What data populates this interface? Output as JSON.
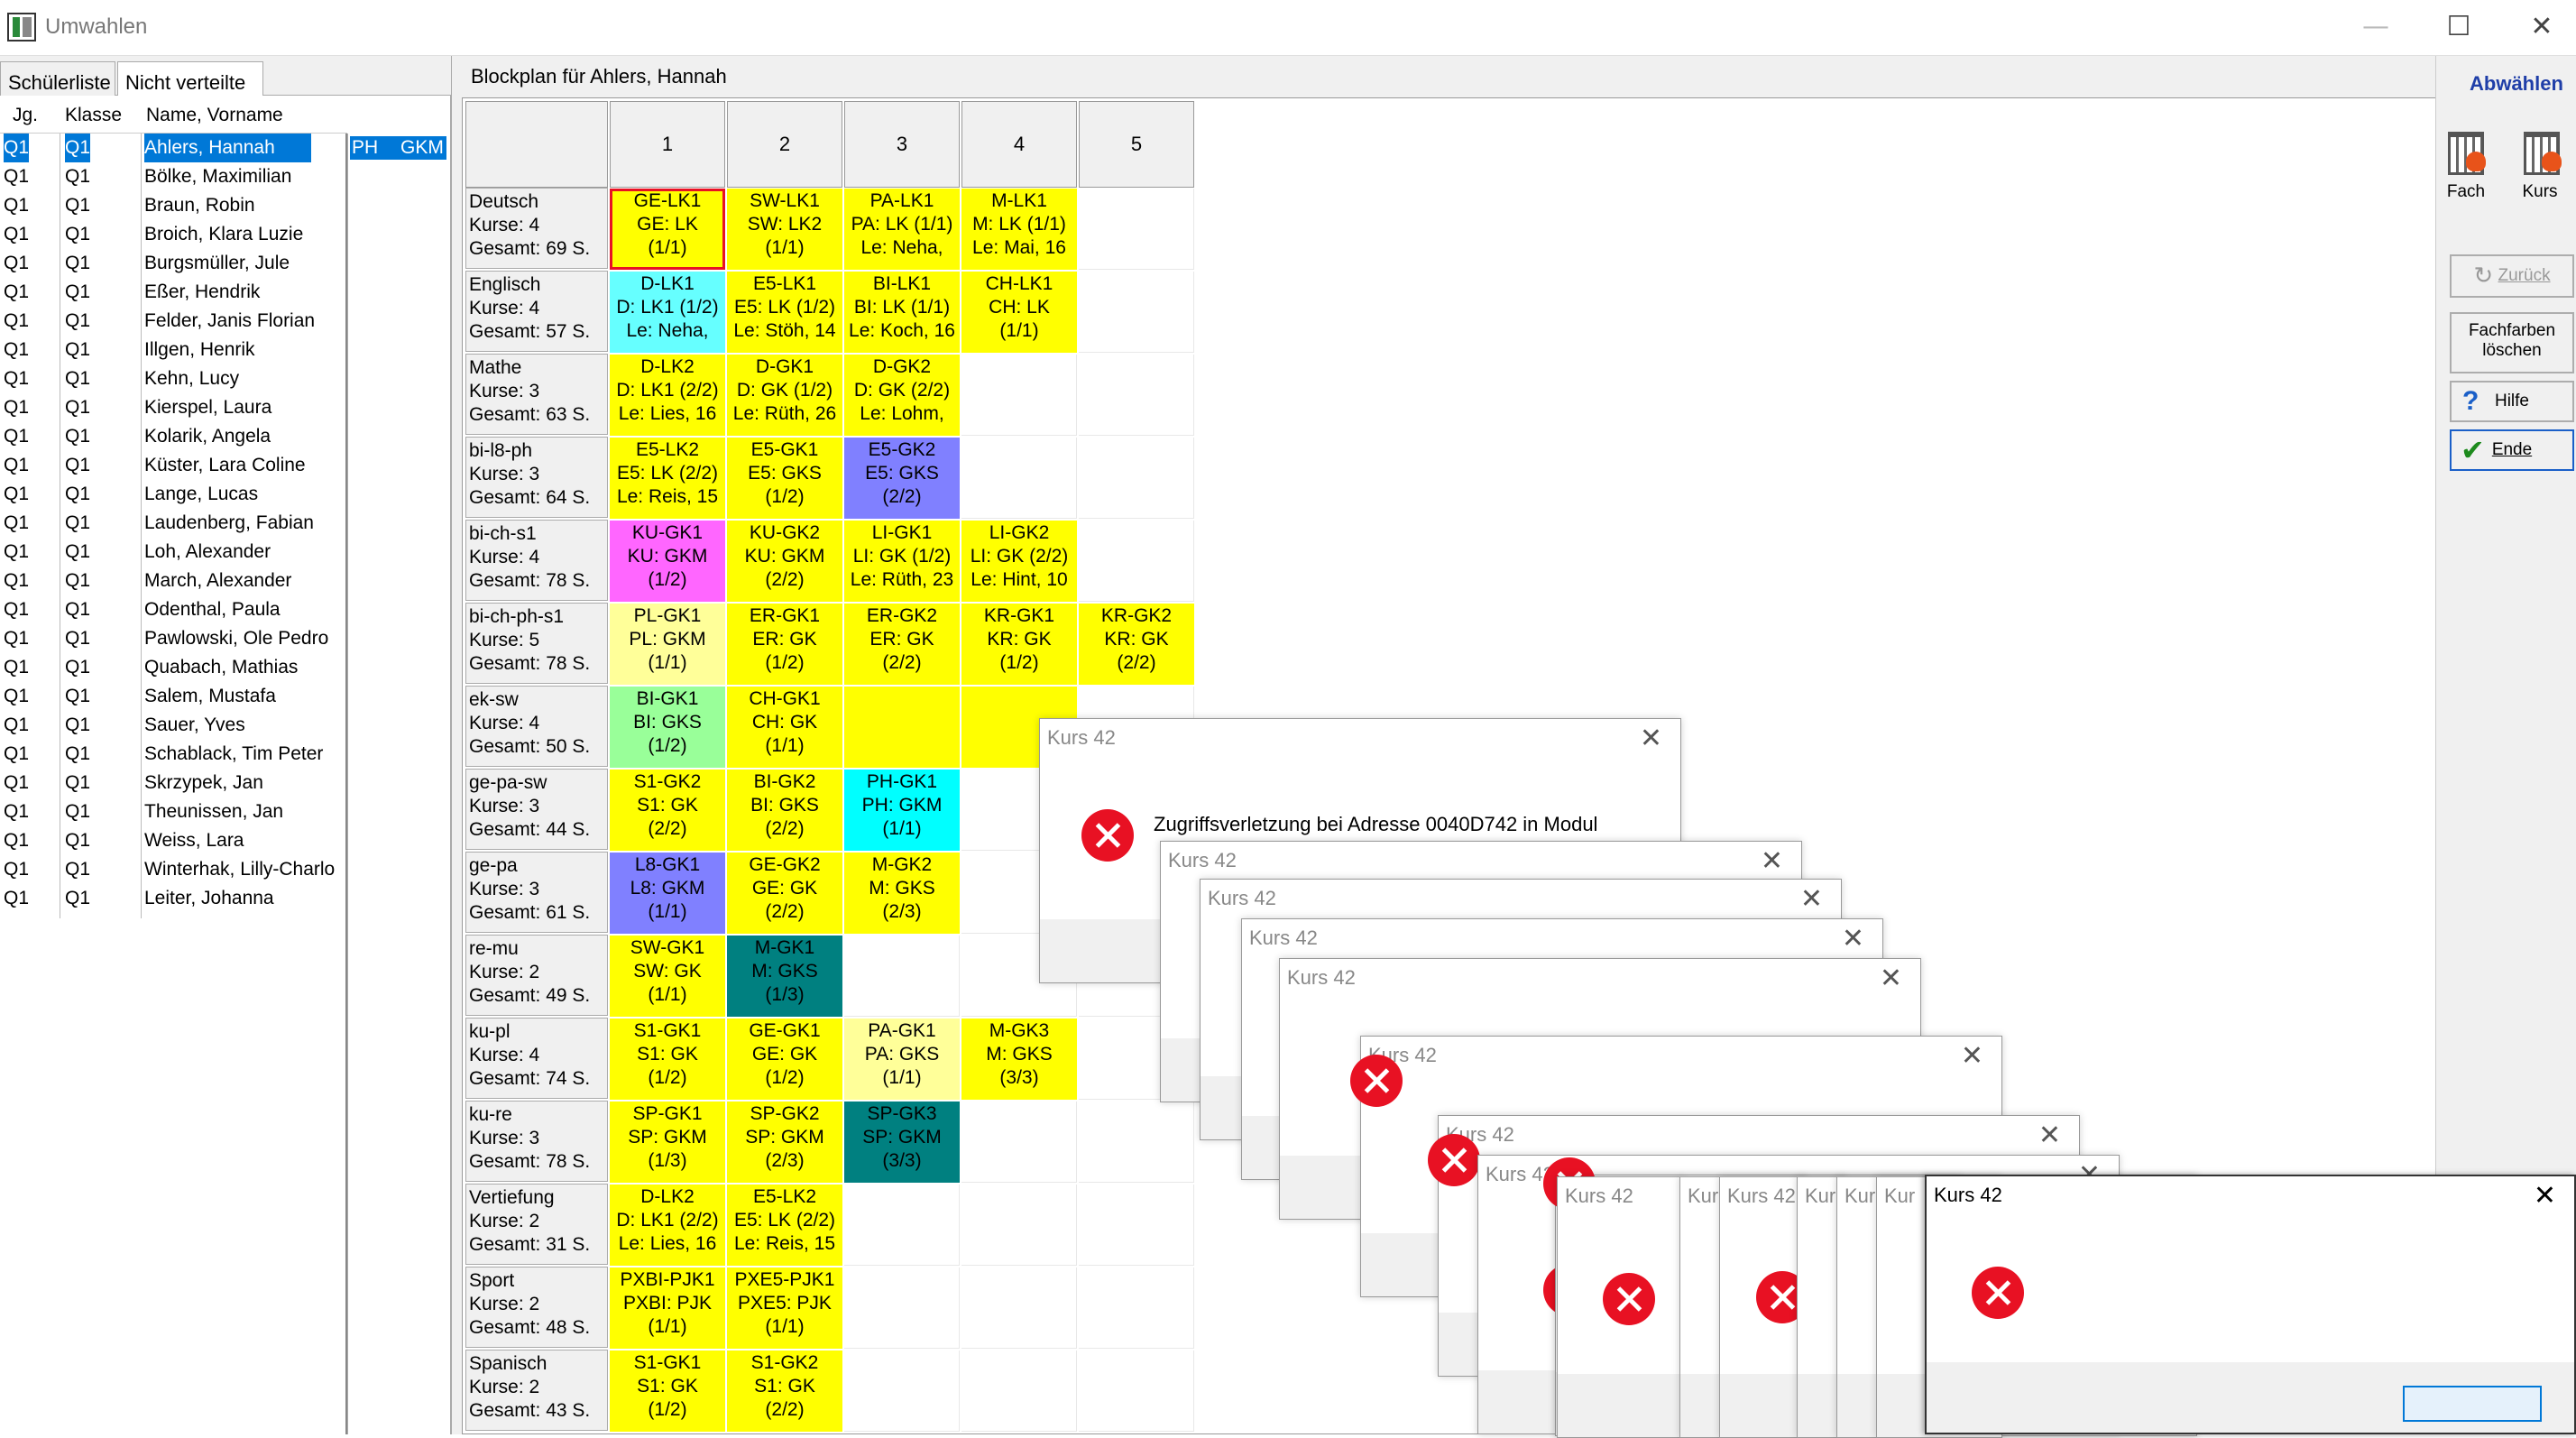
{
  "window": {
    "title": "Umwahlen",
    "minimize": "—",
    "maximize": "☐",
    "close": "✕"
  },
  "tabs": [
    "Schülerliste",
    "Nicht verteilte"
  ],
  "student_list": {
    "headers": [
      "Jg.",
      "Klasse",
      "Name, Vorname"
    ],
    "rows": [
      {
        "jg": "Q1",
        "klasse": "Q1",
        "name": "Ahlers, Hannah"
      },
      {
        "jg": "Q1",
        "klasse": "Q1",
        "name": "Bölke, Maximilian"
      },
      {
        "jg": "Q1",
        "klasse": "Q1",
        "name": "Braun, Robin"
      },
      {
        "jg": "Q1",
        "klasse": "Q1",
        "name": "Broich, Klara Luzie"
      },
      {
        "jg": "Q1",
        "klasse": "Q1",
        "name": "Burgsmüller, Jule"
      },
      {
        "jg": "Q1",
        "klasse": "Q1",
        "name": "Eßer, Hendrik"
      },
      {
        "jg": "Q1",
        "klasse": "Q1",
        "name": "Felder, Janis Florian"
      },
      {
        "jg": "Q1",
        "klasse": "Q1",
        "name": "Illgen, Henrik"
      },
      {
        "jg": "Q1",
        "klasse": "Q1",
        "name": "Kehn, Lucy"
      },
      {
        "jg": "Q1",
        "klasse": "Q1",
        "name": "Kierspel, Laura"
      },
      {
        "jg": "Q1",
        "klasse": "Q1",
        "name": "Kolarik, Angela"
      },
      {
        "jg": "Q1",
        "klasse": "Q1",
        "name": "Küster, Lara Coline"
      },
      {
        "jg": "Q1",
        "klasse": "Q1",
        "name": "Lange, Lucas"
      },
      {
        "jg": "Q1",
        "klasse": "Q1",
        "name": "Laudenberg, Fabian"
      },
      {
        "jg": "Q1",
        "klasse": "Q1",
        "name": "Loh, Alexander"
      },
      {
        "jg": "Q1",
        "klasse": "Q1",
        "name": "March, Alexander"
      },
      {
        "jg": "Q1",
        "klasse": "Q1",
        "name": "Odenthal, Paula"
      },
      {
        "jg": "Q1",
        "klasse": "Q1",
        "name": "Pawlowski, Ole Pedro"
      },
      {
        "jg": "Q1",
        "klasse": "Q1",
        "name": "Quabach, Mathias"
      },
      {
        "jg": "Q1",
        "klasse": "Q1",
        "name": "Salem, Mustafa"
      },
      {
        "jg": "Q1",
        "klasse": "Q1",
        "name": "Sauer, Yves"
      },
      {
        "jg": "Q1",
        "klasse": "Q1",
        "name": "Schablack, Tim Peter"
      },
      {
        "jg": "Q1",
        "klasse": "Q1",
        "name": "Skrzypek, Jan"
      },
      {
        "jg": "Q1",
        "klasse": "Q1",
        "name": "Theunissen, Jan"
      },
      {
        "jg": "Q1",
        "klasse": "Q1",
        "name": "Weiss, Lara"
      },
      {
        "jg": "Q1",
        "klasse": "Q1",
        "name": "Winterhak, Lilly-Charlo"
      },
      {
        "jg": "Q1",
        "klasse": "Q1",
        "name": "Leiter, Johanna"
      }
    ],
    "selected_courses": {
      "c1": "PH",
      "c2": "GKM"
    }
  },
  "blockplan": {
    "title": "Blockplan für Ahlers, Hannah",
    "columns": [
      "1",
      "2",
      "3",
      "4",
      "5"
    ],
    "rows": [
      {
        "h": [
          "Deutsch",
          "Kurse: 4",
          "Gesamt: 69 S."
        ],
        "cells": [
          {
            "t": [
              "GE-LK1",
              "GE: LK",
              "(1/1)"
            ],
            "c": "#ffff00",
            "b": true
          },
          {
            "t": [
              "SW-LK1",
              "SW: LK2",
              "(1/1)"
            ],
            "c": "#ffff00"
          },
          {
            "t": [
              "PA-LK1",
              "PA: LK (1/1)",
              "Le: Neha,"
            ],
            "c": "#ffff00"
          },
          {
            "t": [
              "M-LK1",
              "M: LK (1/1)",
              "Le: Mai, 16"
            ],
            "c": "#ffff00"
          },
          null
        ]
      },
      {
        "h": [
          "Englisch",
          "Kurse: 4",
          "Gesamt: 57 S."
        ],
        "cells": [
          {
            "t": [
              "D-LK1",
              "D: LK1 (1/2)",
              "Le: Neha,"
            ],
            "c": "#66ffff"
          },
          {
            "t": [
              "E5-LK1",
              "E5: LK (1/2)",
              "Le: Stöh, 14"
            ],
            "c": "#ffff00"
          },
          {
            "t": [
              "BI-LK1",
              "BI: LK (1/1)",
              "Le: Koch, 16"
            ],
            "c": "#ffff00"
          },
          {
            "t": [
              "CH-LK1",
              "CH: LK",
              "(1/1)"
            ],
            "c": "#ffff00"
          },
          null
        ]
      },
      {
        "h": [
          "Mathe",
          "Kurse: 3",
          "Gesamt: 63 S."
        ],
        "cells": [
          {
            "t": [
              "D-LK2",
              "D: LK1 (2/2)",
              "Le: Lies, 16"
            ],
            "c": "#ffff00"
          },
          {
            "t": [
              "D-GK1",
              "D: GK (1/2)",
              "Le: Rüth, 26"
            ],
            "c": "#ffff00"
          },
          {
            "t": [
              "D-GK2",
              "D: GK (2/2)",
              "Le: Lohm,"
            ],
            "c": "#ffff00"
          },
          null,
          null
        ]
      },
      {
        "h": [
          "bi-l8-ph",
          "Kurse: 3",
          "Gesamt: 64 S."
        ],
        "cells": [
          {
            "t": [
              "E5-LK2",
              "E5: LK (2/2)",
              "Le: Reis, 15"
            ],
            "c": "#ffff00"
          },
          {
            "t": [
              "E5-GK1",
              "E5: GKS",
              "(1/2)"
            ],
            "c": "#ffff00"
          },
          {
            "t": [
              "E5-GK2",
              "E5: GKS",
              "(2/2)"
            ],
            "c": "#8080ff"
          },
          null,
          null
        ]
      },
      {
        "h": [
          "bi-ch-s1",
          "Kurse: 4",
          "Gesamt: 78 S."
        ],
        "cells": [
          {
            "t": [
              "KU-GK1",
              "KU: GKM",
              "(1/2)"
            ],
            "c": "#ff66ff"
          },
          {
            "t": [
              "KU-GK2",
              "KU: GKM",
              "(2/2)"
            ],
            "c": "#ffff00"
          },
          {
            "t": [
              "LI-GK1",
              "LI: GK (1/2)",
              "Le: Rüth, 23"
            ],
            "c": "#ffff00"
          },
          {
            "t": [
              "LI-GK2",
              "LI: GK (2/2)",
              "Le: Hint, 10"
            ],
            "c": "#ffff00"
          },
          null
        ]
      },
      {
        "h": [
          "bi-ch-ph-s1",
          "Kurse: 5",
          "Gesamt: 78 S."
        ],
        "cells": [
          {
            "t": [
              "PL-GK1",
              "PL: GKM",
              "(1/1)"
            ],
            "c": "#ffff99"
          },
          {
            "t": [
              "ER-GK1",
              "ER: GK",
              "(1/2)"
            ],
            "c": "#ffff00"
          },
          {
            "t": [
              "ER-GK2",
              "ER: GK",
              "(2/2)"
            ],
            "c": "#ffff00"
          },
          {
            "t": [
              "KR-GK1",
              "KR: GK",
              "(1/2)"
            ],
            "c": "#ffff00"
          },
          {
            "t": [
              "KR-GK2",
              "KR: GK",
              "(2/2)"
            ],
            "c": "#ffff00"
          }
        ]
      },
      {
        "h": [
          "ek-sw",
          "Kurse: 4",
          "Gesamt: 50 S."
        ],
        "cells": [
          {
            "t": [
              "BI-GK1",
              "BI: GKS",
              "(1/2)"
            ],
            "c": "#99ff99"
          },
          {
            "t": [
              "CH-GK1",
              "CH: GK",
              "(1/1)"
            ],
            "c": "#ffff00"
          },
          {
            "t": [],
            "c": "#ffff00"
          },
          {
            "t": [],
            "c": "#ffff00"
          },
          null
        ]
      },
      {
        "h": [
          "ge-pa-sw",
          "Kurse: 3",
          "Gesamt: 44 S."
        ],
        "cells": [
          {
            "t": [
              "S1-GK2",
              "S1: GK",
              "(2/2)"
            ],
            "c": "#ffff00"
          },
          {
            "t": [
              "BI-GK2",
              "BI: GKS",
              "(2/2)"
            ],
            "c": "#ffff00"
          },
          {
            "t": [
              "PH-GK1",
              "PH: GKM",
              "(1/1)"
            ],
            "c": "#00ffff"
          },
          null,
          null
        ]
      },
      {
        "h": [
          "ge-pa",
          "Kurse: 3",
          "Gesamt: 61 S."
        ],
        "cells": [
          {
            "t": [
              "L8-GK1",
              "L8: GKM",
              "(1/1)"
            ],
            "c": "#8080ff"
          },
          {
            "t": [
              "GE-GK2",
              "GE: GK",
              "(2/2)"
            ],
            "c": "#ffff00"
          },
          {
            "t": [
              "M-GK2",
              "M: GKS",
              "(2/3)"
            ],
            "c": "#ffff00"
          },
          null,
          null
        ]
      },
      {
        "h": [
          "re-mu",
          "Kurse: 2",
          "Gesamt: 49 S."
        ],
        "cells": [
          {
            "t": [
              "SW-GK1",
              "SW: GK",
              "(1/1)"
            ],
            "c": "#ffff00"
          },
          {
            "t": [
              "M-GK1",
              "M: GKS",
              "(1/3)"
            ],
            "c": "#008080"
          },
          null,
          null,
          null
        ]
      },
      {
        "h": [
          "ku-pl",
          "Kurse: 4",
          "Gesamt: 74 S."
        ],
        "cells": [
          {
            "t": [
              "S1-GK1",
              "S1: GK",
              "(1/2)"
            ],
            "c": "#ffff00"
          },
          {
            "t": [
              "GE-GK1",
              "GE: GK",
              "(1/2)"
            ],
            "c": "#ffff00"
          },
          {
            "t": [
              "PA-GK1",
              "PA: GKS",
              "(1/1)"
            ],
            "c": "#ffff99"
          },
          {
            "t": [
              "M-GK3",
              "M: GKS",
              "(3/3)"
            ],
            "c": "#ffff00"
          },
          null
        ]
      },
      {
        "h": [
          "ku-re",
          "Kurse: 3",
          "Gesamt: 78 S."
        ],
        "cells": [
          {
            "t": [
              "SP-GK1",
              "SP: GKM",
              "(1/3)"
            ],
            "c": "#ffff00"
          },
          {
            "t": [
              "SP-GK2",
              "SP: GKM",
              "(2/3)"
            ],
            "c": "#ffff00"
          },
          {
            "t": [
              "SP-GK3",
              "SP: GKM",
              "(3/3)"
            ],
            "c": "#008080"
          },
          null,
          null
        ]
      },
      {
        "h": [
          "Vertiefung",
          "Kurse: 2",
          "Gesamt: 31 S."
        ],
        "cells": [
          {
            "t": [
              "D-LK2",
              "D: LK1 (2/2)",
              "Le: Lies, 16"
            ],
            "c": "#ffff00"
          },
          {
            "t": [
              "E5-LK2",
              "E5: LK (2/2)",
              "Le: Reis, 15"
            ],
            "c": "#ffff00"
          },
          null,
          null,
          null
        ]
      },
      {
        "h": [
          "Sport",
          "Kurse: 2",
          "Gesamt: 48 S."
        ],
        "cells": [
          {
            "t": [
              "PXBI-PJK1",
              "PXBI: PJK",
              "(1/1)"
            ],
            "c": "#ffff00"
          },
          {
            "t": [
              "PXE5-PJK1",
              "PXE5: PJK",
              "(1/1)"
            ],
            "c": "#ffff00"
          },
          null,
          null,
          null
        ]
      },
      {
        "h": [
          "Spanisch",
          "Kurse: 2",
          "Gesamt: 43 S."
        ],
        "cells": [
          {
            "t": [
              "S1-GK1",
              "S1: GK",
              "(1/2)"
            ],
            "c": "#ffff00"
          },
          {
            "t": [
              "S1-GK2",
              "S1: GK",
              "(2/2)"
            ],
            "c": "#ffff00"
          },
          null,
          null,
          null
        ]
      }
    ]
  },
  "right_toolbar": {
    "abwaehlen": "Abwählen",
    "fach": "Fach",
    "kurs": "Kurs",
    "zurueck": "Zurück",
    "fachfarben1": "Fachfarben",
    "fachfarben2": "löschen",
    "hilfe": "Hilfe",
    "ende": "Ende"
  },
  "dialogs": {
    "title": "Kurs 42",
    "title_short": "Kur",
    "title_tiny": "Kur",
    "message": "Zugriffsverletzung bei Adresse 0040D742 in Modul",
    "frag": "Z",
    "close": "✕"
  }
}
